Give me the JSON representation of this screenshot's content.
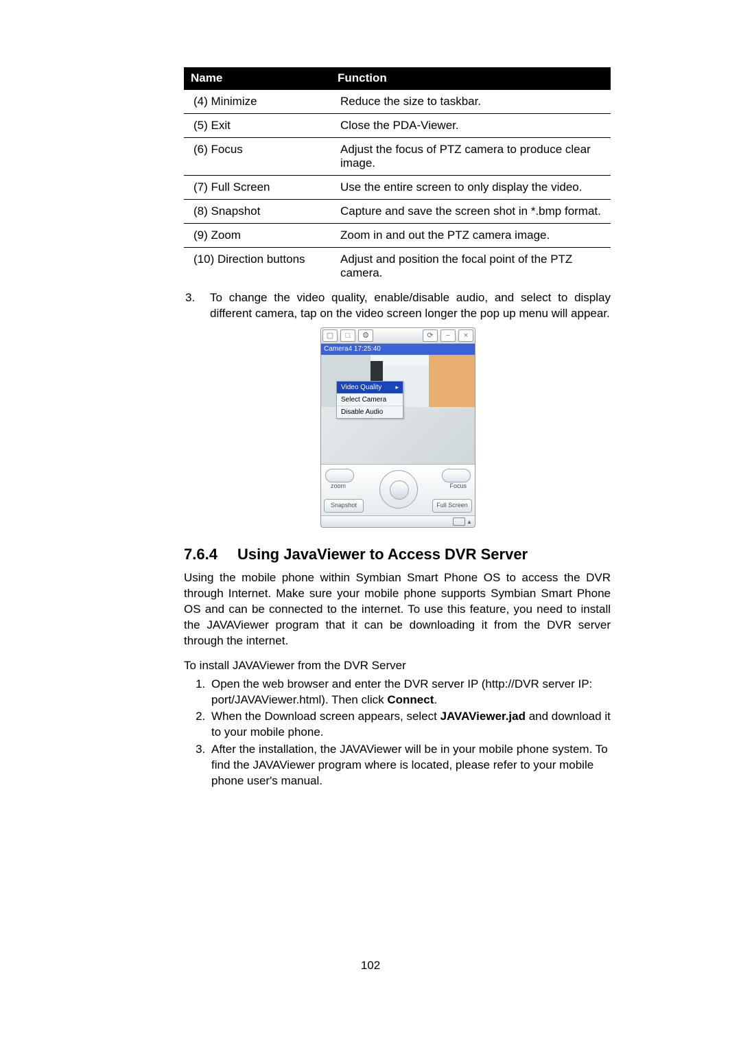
{
  "table": {
    "headers": {
      "name": "Name",
      "function": "Function"
    },
    "rows": [
      {
        "name": "(4) Minimize",
        "func": "Reduce the size to taskbar."
      },
      {
        "name": "(5) Exit",
        "func": "Close the PDA-Viewer."
      },
      {
        "name": "(6) Focus",
        "func": "Adjust the focus of PTZ camera to produce clear image."
      },
      {
        "name": "(7) Full Screen",
        "func": "Use the entire screen to only display the video."
      },
      {
        "name": "(8) Snapshot",
        "func": "Capture and save the screen shot in *.bmp format."
      },
      {
        "name": "(9) Zoom",
        "func": "Zoom in and out the PTZ camera image."
      },
      {
        "name": "(10) Direction buttons",
        "func": "Adjust and position the focal point of the PTZ camera."
      }
    ]
  },
  "note3": {
    "num": "3.",
    "text": "To change the video quality, enable/disable audio, and select to display different camera, tap on the video screen longer the pop up menu will appear."
  },
  "pda": {
    "label": "Camera4  17:25:40",
    "menu": {
      "video_quality": "Video Quality",
      "select_camera": "Select Camera",
      "disable_audio": "Disable Audio"
    },
    "controls": {
      "zoom": "zoom",
      "focus": "Focus",
      "snapshot": "Snapshot",
      "fullscreen": "Full Screen"
    }
  },
  "section": {
    "num": "7.6.4",
    "title": "Using JavaViewer to Access DVR Server",
    "para": "Using the mobile phone within Symbian Smart Phone OS to access the DVR through Internet. Make sure your mobile phone supports Symbian Smart Phone OS and can be connected to the internet. To use this feature, you need to install the JAVAViewer program that it can be downloading it from the DVR server through the internet.",
    "subhead": "To install JAVAViewer from the DVR Server",
    "steps": {
      "s1a": "Open the web browser and enter the DVR server IP (http://DVR server IP: port/JAVAViewer.html). Then click ",
      "s1b": "Connect",
      "s1c": ".",
      "s2a": "When the Download screen appears, select ",
      "s2b": "JAVAViewer.jad",
      "s2c": " and download it to your mobile phone.",
      "s3": "After the installation, the JAVAViewer will be in your mobile phone system. To find the JAVAViewer program where is located, please refer to your mobile phone user's manual."
    }
  },
  "page_number": "102"
}
